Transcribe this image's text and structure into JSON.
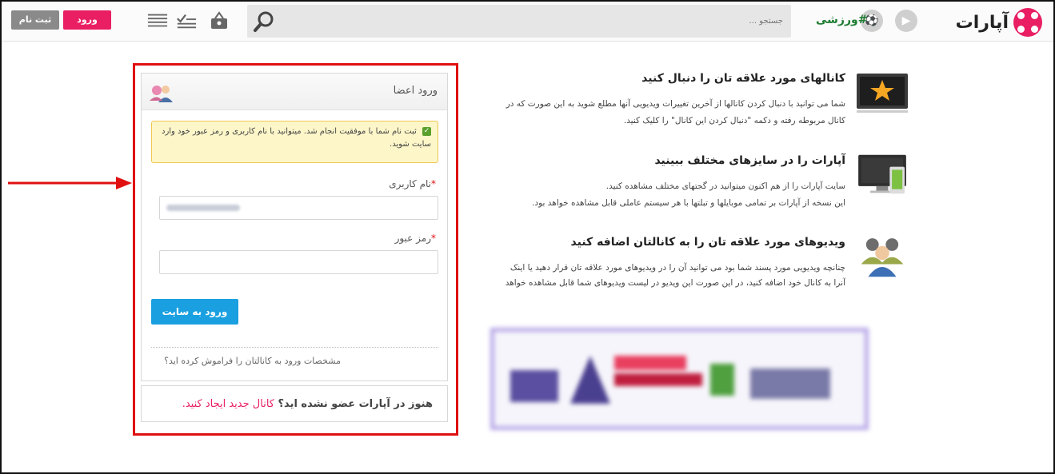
{
  "header": {
    "logo_text": "آپارات",
    "hashtag": "#ورزشی",
    "search_placeholder": "جستجو ...",
    "login_label": "ورود",
    "register_label": "ثبت نام",
    "accent_color": "#e91e63"
  },
  "login": {
    "title": "ورود اعضا",
    "alert_text": "ثبت نام شما با موفقیت انجام شد. میتوانید با نام کاربری و رمز عبور خود وارد سایت شوید.",
    "username_label": "نام کاربری",
    "password_label": "رمز عبور",
    "required_mark": "*",
    "submit_label": "ورود به سایت",
    "forgot_text": "مشخصات ورود به کانالتان را فراموش کرده اید؟",
    "join_prompt": "هنوز در آپارات عضو نشده اید؟",
    "join_link": "کانال جدید ایجاد کنید."
  },
  "features": [
    {
      "title": "کانالهای مورد علاقه تان را دنبال کنید",
      "line1": "شما می توانید با دنبال کردن کانالها از آخرین تغییرات ویدیویی آنها مطلع شوید به این صورت که در",
      "line2": "کانال مربوطه رفته و دکمه \"دنبال کردن این کانال\" را کلیک کنید.",
      "icon": "tv-star-icon"
    },
    {
      "title": "آپارات را در سایزهای مختلف ببینید",
      "line1": "سایت آپارات را از هم اکنون میتوانید در گجتهای مختلف مشاهده کنید.",
      "line2": "این نسخه از آپارات بر تمامی موبایلها و تبلتها با هر سیستم عاملی قابل مشاهده خواهد بود.",
      "icon": "devices-icon"
    },
    {
      "title": "ویدیوهای مورد علاقه تان را به کانالتان اضافه کنید",
      "line1": "چنانچه ویدیویی مورد پسند شما بود می توانید آن را در ویدیوهای مورد علاقه تان قرار دهید یا اینک",
      "line2": "آنرا به کانال خود اضافه کنید، در این صورت این ویدیو در لیست ویدیوهای شما قابل مشاهده خواهد",
      "icon": "users-group-icon"
    }
  ]
}
